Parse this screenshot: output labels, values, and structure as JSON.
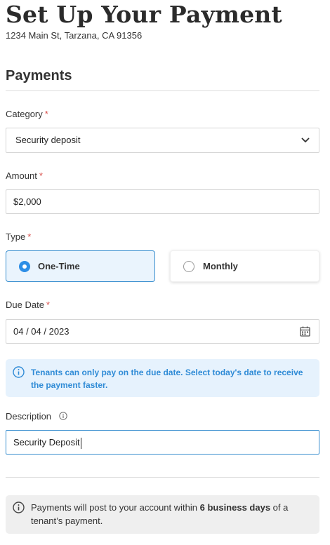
{
  "header": {
    "title": "Set Up Your Payment",
    "address": "1234 Main St, Tarzana, CA 91356"
  },
  "section": {
    "title": "Payments"
  },
  "category": {
    "label": "Category",
    "required_mark": "*",
    "selected": "Security deposit",
    "icon": "chevron-down-icon"
  },
  "amount": {
    "label": "Amount",
    "required_mark": "*",
    "value": "$2,000"
  },
  "type": {
    "label": "Type",
    "required_mark": "*",
    "options": [
      {
        "label": "One-Time",
        "selected": true
      },
      {
        "label": "Monthly",
        "selected": false
      }
    ]
  },
  "due_date": {
    "label": "Due Date",
    "required_mark": "*",
    "value": "04 / 04 / 2023",
    "icon": "calendar-icon"
  },
  "notice": {
    "icon": "info-icon",
    "text": "Tenants can only pay on the due date. Select today's date to receive the payment faster."
  },
  "description": {
    "label": "Description",
    "icon": "info-icon",
    "value": "Security Deposit"
  },
  "footer_notice": {
    "icon": "info-icon",
    "text_before": "Payments will post to your account within ",
    "text_bold": "6 business days",
    "text_after": " of a tenant’s payment."
  },
  "colors": {
    "accent": "#2d8ee6",
    "required": "#d9534f",
    "info_bg": "#e6f2fd",
    "info_text": "#2f8bd6"
  }
}
